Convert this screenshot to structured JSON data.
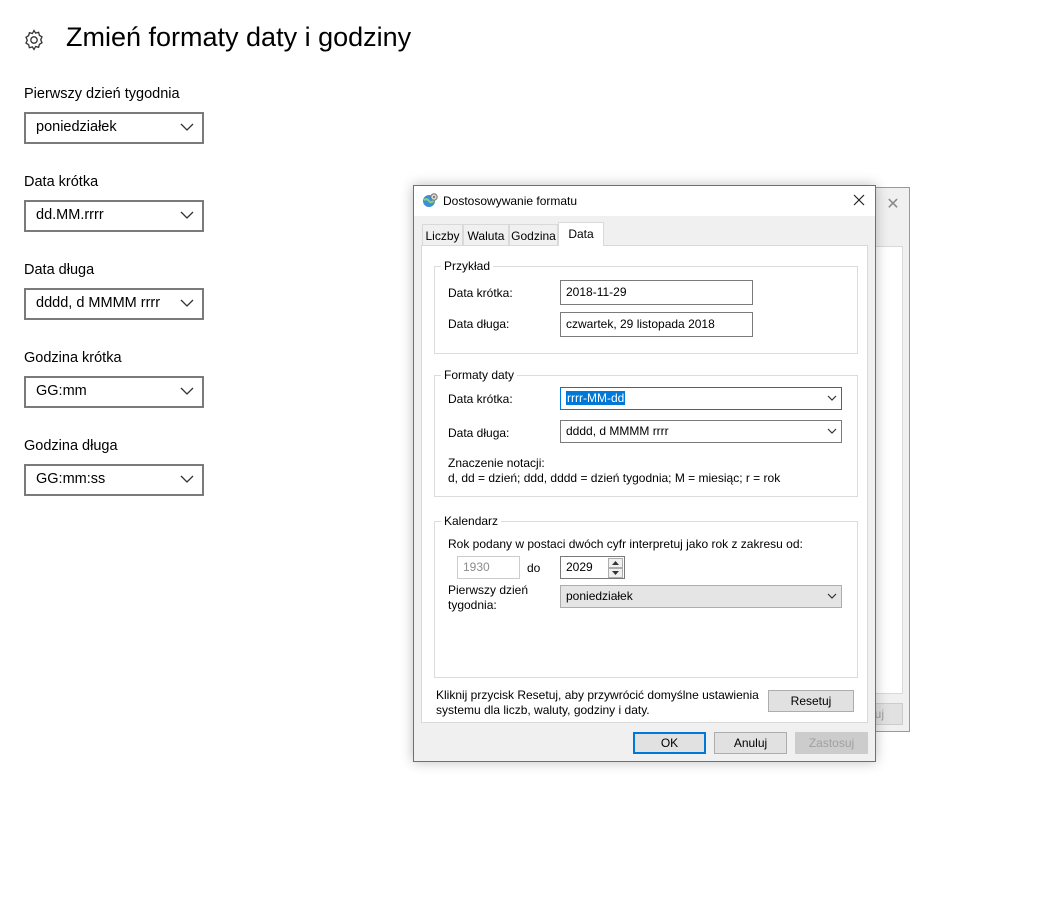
{
  "page": {
    "title": "Zmień formaty daty i godziny",
    "fields": [
      {
        "label": "Pierwszy dzień tygodnia",
        "value": "poniedziałek"
      },
      {
        "label": "Data krótka",
        "value": "dd.MM.rrrr"
      },
      {
        "label": "Data długa",
        "value": "dddd, d MMMM rrrr"
      },
      {
        "label": "Godzina krótka",
        "value": "GG:mm"
      },
      {
        "label": "Godzina długa",
        "value": "GG:mm:ss"
      }
    ]
  },
  "background_dialog": {
    "button_fragment": "uj"
  },
  "dialog": {
    "title": "Dostosowywanie formatu",
    "tabs": [
      "Liczby",
      "Waluta",
      "Godzina",
      "Data"
    ],
    "active_tab": "Data",
    "example": {
      "group_title": "Przykład",
      "short_label": "Data krótka:",
      "short_value": "2018-11-29",
      "long_label": "Data długa:",
      "long_value": "czwartek, 29 listopada 2018"
    },
    "formats": {
      "group_title": "Formaty daty",
      "short_label": "Data krótka:",
      "short_value": "rrrr-MM-dd",
      "long_label": "Data długa:",
      "long_value": "dddd, d MMMM rrrr",
      "notation_title": "Znaczenie notacji:",
      "notation_text": "d, dd = dzień;  ddd, dddd = dzień tygodnia;  M = miesiąc;  r = rok"
    },
    "calendar": {
      "group_title": "Kalendarz",
      "range_text": "Rok podany w postaci dwóch cyfr interpretuj jako rok z zakresu od:",
      "from_year": "1930",
      "to_label": "do",
      "to_year": "2029",
      "first_day_label_1": "Pierwszy dzień",
      "first_day_label_2": "tygodnia:",
      "first_day_value": "poniedziałek"
    },
    "reset_text_1": "Kliknij przycisk Resetuj, aby przywrócić domyślne ustawienia",
    "reset_text_2": "systemu dla liczb, waluty, godziny i daty.",
    "reset_button": "Resetuj",
    "ok_button": "OK",
    "cancel_button": "Anuluj",
    "apply_button": "Zastosuj"
  },
  "colors": {
    "accent": "#0078d7",
    "dialog_border": "#2b7de2",
    "dialog_bg": "#f0f0f0"
  }
}
